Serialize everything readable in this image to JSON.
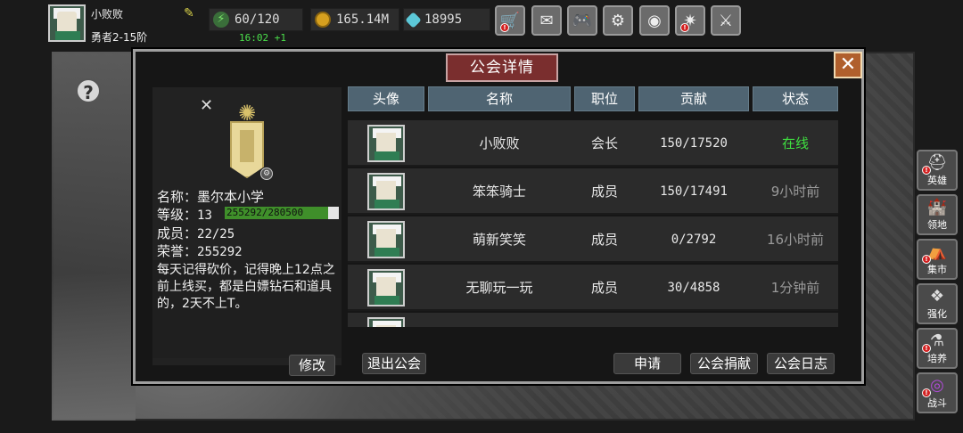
{
  "player": {
    "name": "小败败",
    "rank": "勇者2-15阶",
    "stamina": "60/120",
    "stamina_timer": "16:02 +1",
    "gold": "165.14M",
    "gems": "18995"
  },
  "top_icons": [
    "shop-cart-icon",
    "mail-icon",
    "gamepad-icon",
    "gear-icon",
    "color-wheel-icon",
    "firework-icon",
    "swords-icon"
  ],
  "side_menu": [
    "英雄",
    "领地",
    "集市",
    "强化",
    "培养",
    "战斗"
  ],
  "modal": {
    "title": "公会详情",
    "guild": {
      "name_label": "名称：",
      "name": "墨尔本小学",
      "level_label": "等级：",
      "level": "13",
      "exp": "255292/280500",
      "exp_fraction": 0.91,
      "members_label": "成员：",
      "members": "22/25",
      "honor_label": "荣誉：",
      "honor": "255292",
      "notice": "每天记得砍价，记得晚上12点之前上线买，都是白嫖钻石和道具的，2天不上T。",
      "edit_button": "修改"
    },
    "columns": [
      "头像",
      "名称",
      "职位",
      "贡献",
      "状态"
    ],
    "members": [
      {
        "name": "小败败",
        "role": "会长",
        "contribution": "150/17520",
        "status": "在线",
        "online": true
      },
      {
        "name": "笨笨骑士",
        "role": "成员",
        "contribution": "150/17491",
        "status": "9小时前",
        "online": false
      },
      {
        "name": "萌新笑笑",
        "role": "成员",
        "contribution": "0/2792",
        "status": "16小时前",
        "online": false
      },
      {
        "name": "无聊玩一玩",
        "role": "成员",
        "contribution": "30/4858",
        "status": "1分钟前",
        "online": false
      }
    ],
    "buttons": {
      "leave": "退出公会",
      "apply": "申请",
      "donate": "公会捐献",
      "log": "公会日志"
    }
  },
  "colors": {
    "online": "#3fe040",
    "title_bg": "#7a2e2e",
    "header_bg": "#4f6472",
    "exp_fill": "#3f8f2a"
  }
}
